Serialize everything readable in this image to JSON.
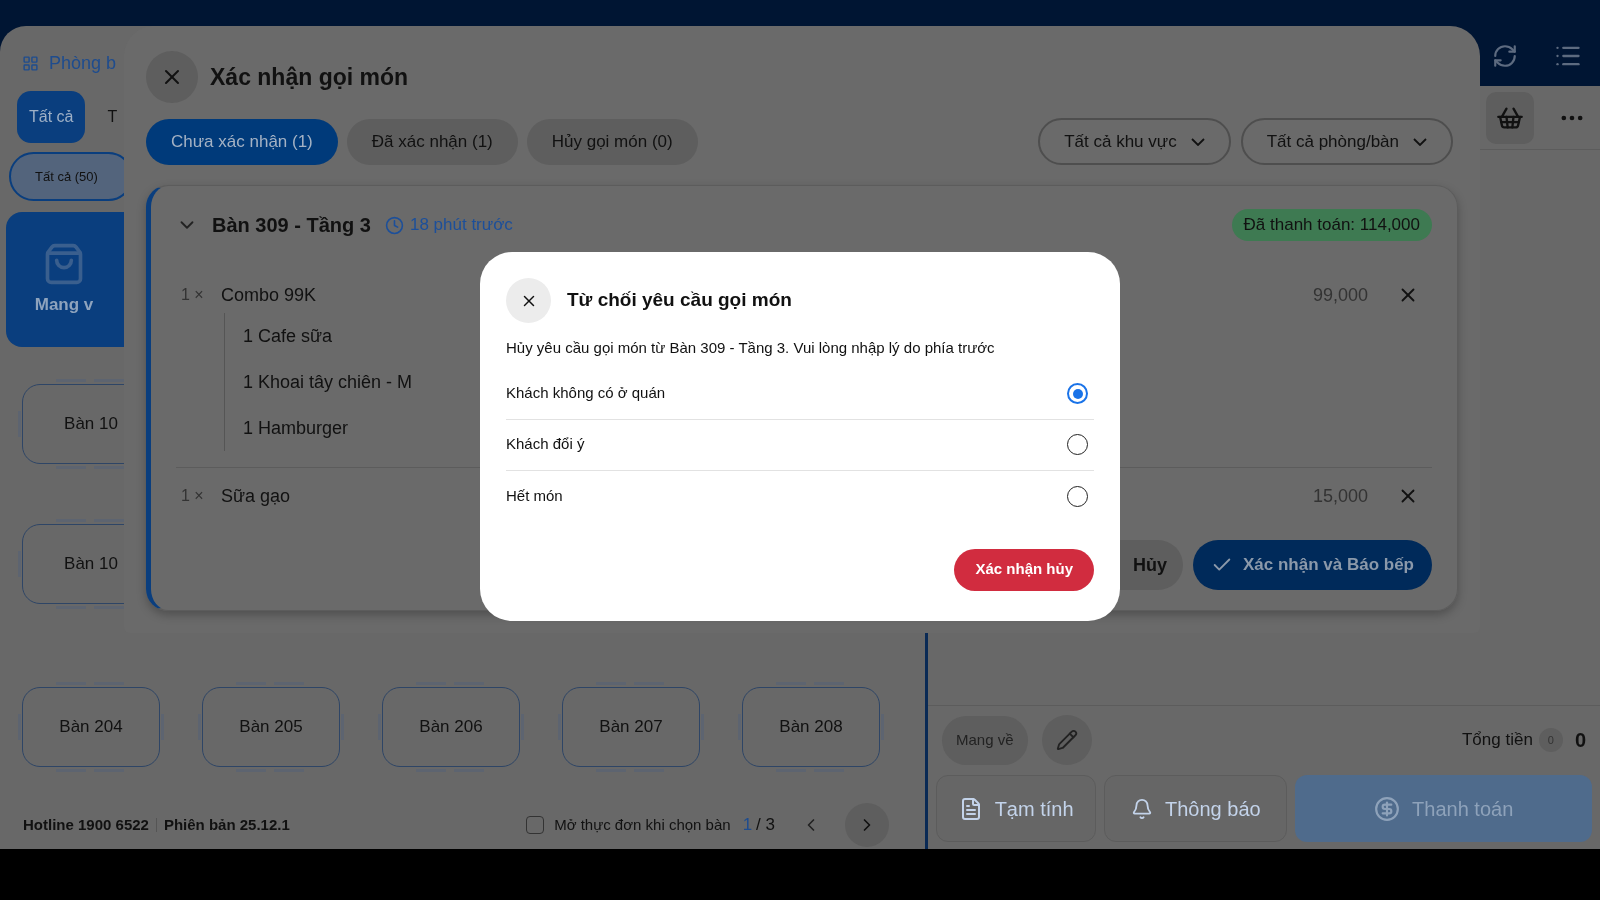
{
  "sidebar": {
    "title": "Phòng b",
    "tabs": [
      {
        "label": "Tất cả",
        "selected": true
      },
      {
        "label": "T",
        "selected": false
      }
    ],
    "filter_chip": {
      "label": "Tất cả (50)",
      "selected": true
    },
    "takeaway": {
      "label": "Mang v"
    },
    "tables": [
      {
        "label": "Bàn 10"
      },
      {
        "label": "Bàn 10"
      }
    ]
  },
  "tables": [
    {
      "label": "Bàn 204"
    },
    {
      "label": "Bàn 205"
    },
    {
      "label": "Bàn 206"
    },
    {
      "label": "Bàn 207"
    },
    {
      "label": "Bàn 208"
    }
  ],
  "footer": {
    "hotline": "Hotline 1900 6522",
    "version": "Phiên bản 25.12.1",
    "open_menu": {
      "label": "Mở thực đơn khi chọn bàn",
      "checked": false
    },
    "page": {
      "current": "1",
      "total": "/ 3"
    }
  },
  "order_pane": {
    "order_type": "Mang về",
    "total_label": "Tổng tiền",
    "total_count": "0",
    "total": "0",
    "buttons": [
      {
        "label": "Tạm tính",
        "kind": "document"
      },
      {
        "label": "Thông báo",
        "kind": "bell"
      },
      {
        "label": "Thanh toán",
        "kind": "primary"
      }
    ]
  },
  "panel": {
    "title": "Xác nhận gọi món",
    "tabs": [
      {
        "label": "Chưa xác nhận (1)",
        "selected": true
      },
      {
        "label": "Đã xác nhận (1)",
        "selected": false
      },
      {
        "label": "Hủy gọi món (0)",
        "selected": false
      }
    ],
    "filters": [
      "Tất cả khu vực",
      "Tất cả phòng/bàn"
    ],
    "order": {
      "expanded": true,
      "table": "Bàn 309 - Tầng 3",
      "time": "18 phút trước",
      "payment_badge": "Đã thanh toán: 114,000",
      "items": [
        {
          "qty": "1 ×",
          "name": "Combo 99K",
          "price": "99,000",
          "children": [
            {
              "name": "1 Cafe sữa"
            },
            {
              "name": "1 Khoai tây chiên - M"
            },
            {
              "name": "1 Hamburger"
            }
          ]
        },
        {
          "qty": "1 ×",
          "name": "Sữa gạo",
          "price": "15,000"
        }
      ],
      "actions": [
        {
          "label": "Hủy",
          "kind": "secondary"
        },
        {
          "label": "Xác nhận và Báo bếp",
          "kind": "primary"
        }
      ]
    }
  },
  "dialog": {
    "title": "Từ chối yêu cầu gọi món",
    "message": "Hủy yêu cầu gọi món từ Bàn 309 - Tầng 3. Vui lòng nhập lý do phía trước",
    "reasons": [
      {
        "label": "Khách không có ở quán",
        "selected": true
      },
      {
        "label": "Khách đổi ý",
        "selected": false
      },
      {
        "label": "Hết món",
        "selected": false
      }
    ],
    "confirm": "Xác nhận hủy"
  }
}
